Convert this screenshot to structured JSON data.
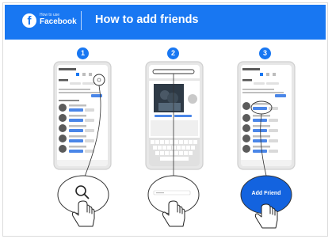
{
  "header": {
    "logo_glyph": "f",
    "brand_small": "How to use",
    "brand_name": "Facebook",
    "title": "How to add friends",
    "color": "#1877f2"
  },
  "steps": [
    {
      "number": "1",
      "action_icon": "search-icon"
    },
    {
      "number": "2",
      "action_icon": "search-field-icon"
    },
    {
      "number": "3",
      "action_label": "Add Friend"
    }
  ],
  "colors": {
    "accent": "#1877f2",
    "phone_frame": "#d6d6d6",
    "ui_blue": "#4a86e8"
  }
}
